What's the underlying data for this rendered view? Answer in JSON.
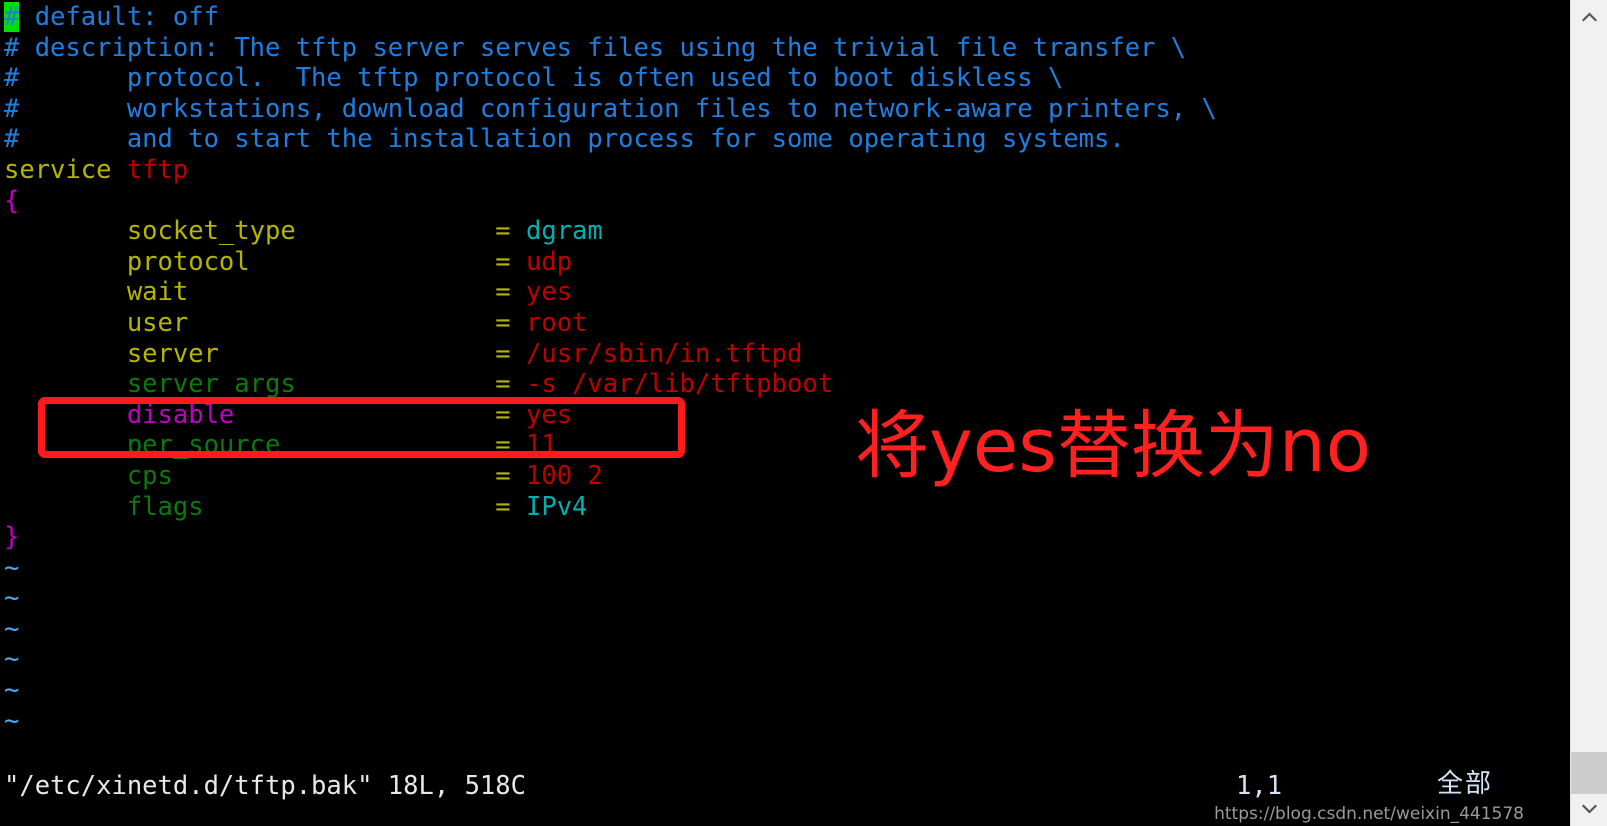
{
  "editor": {
    "lines": [
      {
        "id": "l1",
        "segments": [
          {
            "t": "#",
            "c": "cursor-block"
          },
          {
            "t": " default: off",
            "c": "c-comment"
          }
        ]
      },
      {
        "id": "l2",
        "segments": [
          {
            "t": "# description: The tftp server serves files using the trivial file transfer \\",
            "c": "c-comment"
          }
        ]
      },
      {
        "id": "l3",
        "segments": [
          {
            "t": "#       protocol.  The tftp protocol is often used to boot diskless \\",
            "c": "c-comment"
          }
        ]
      },
      {
        "id": "l4",
        "segments": [
          {
            "t": "#       workstations, download configuration files to network-aware printers, \\",
            "c": "c-comment"
          }
        ]
      },
      {
        "id": "l5",
        "segments": [
          {
            "t": "#       and to start the installation process for some operating systems.",
            "c": "c-comment"
          }
        ]
      },
      {
        "id": "l6",
        "segments": [
          {
            "t": "service ",
            "c": "c-keyword"
          },
          {
            "t": "tftp",
            "c": "c-string"
          }
        ]
      },
      {
        "id": "l7",
        "segments": [
          {
            "t": "{",
            "c": "c-brace"
          }
        ]
      },
      {
        "id": "l8",
        "segments": [
          {
            "t": "        socket_type",
            "c": "c-keyword"
          },
          {
            "t": "             = ",
            "c": "c-op"
          },
          {
            "t": "dgram",
            "c": "c-special"
          }
        ]
      },
      {
        "id": "l9",
        "segments": [
          {
            "t": "        protocol",
            "c": "c-keyword"
          },
          {
            "t": "                = ",
            "c": "c-op"
          },
          {
            "t": "udp",
            "c": "c-string"
          }
        ]
      },
      {
        "id": "l10",
        "segments": [
          {
            "t": "        wait",
            "c": "c-keyword"
          },
          {
            "t": "                    = ",
            "c": "c-op"
          },
          {
            "t": "yes",
            "c": "c-string"
          }
        ]
      },
      {
        "id": "l11",
        "segments": [
          {
            "t": "        user",
            "c": "c-keyword"
          },
          {
            "t": "                    = ",
            "c": "c-op"
          },
          {
            "t": "root",
            "c": "c-string"
          }
        ]
      },
      {
        "id": "l12",
        "segments": [
          {
            "t": "        server",
            "c": "c-keyword"
          },
          {
            "t": "                  = ",
            "c": "c-op"
          },
          {
            "t": "/usr/sbin/in.tftpd",
            "c": "c-string"
          }
        ]
      },
      {
        "id": "l13",
        "segments": [
          {
            "t": "        server_args",
            "c": "c-green"
          },
          {
            "t": "             = ",
            "c": "c-op"
          },
          {
            "t": "-s /var/lib/tftpboot",
            "c": "c-string"
          }
        ]
      },
      {
        "id": "l14",
        "segments": [
          {
            "t": "        disable",
            "c": "c-magenta"
          },
          {
            "t": "                 = ",
            "c": "c-op"
          },
          {
            "t": "yes",
            "c": "c-string"
          }
        ]
      },
      {
        "id": "l15",
        "segments": [
          {
            "t": "        per_source",
            "c": "c-green"
          },
          {
            "t": "              = ",
            "c": "c-op"
          },
          {
            "t": "11",
            "c": "c-string"
          }
        ]
      },
      {
        "id": "l16",
        "segments": [
          {
            "t": "        cps",
            "c": "c-green"
          },
          {
            "t": "                     = ",
            "c": "c-op"
          },
          {
            "t": "100 2",
            "c": "c-string"
          }
        ]
      },
      {
        "id": "l17",
        "segments": [
          {
            "t": "        flags",
            "c": "c-green"
          },
          {
            "t": "                   = ",
            "c": "c-op"
          },
          {
            "t": "IPv4",
            "c": "c-special"
          }
        ]
      },
      {
        "id": "l18",
        "segments": [
          {
            "t": "}",
            "c": "c-brace"
          }
        ]
      },
      {
        "id": "l19",
        "segments": [
          {
            "t": "~",
            "c": "c-tilde"
          }
        ]
      },
      {
        "id": "l20",
        "segments": [
          {
            "t": "~",
            "c": "c-tilde"
          }
        ]
      },
      {
        "id": "l21",
        "segments": [
          {
            "t": "~",
            "c": "c-tilde"
          }
        ]
      },
      {
        "id": "l22",
        "segments": [
          {
            "t": "~",
            "c": "c-tilde"
          }
        ]
      },
      {
        "id": "l23",
        "segments": [
          {
            "t": "~",
            "c": "c-tilde"
          }
        ]
      },
      {
        "id": "l24",
        "segments": [
          {
            "t": "~",
            "c": "c-tilde"
          }
        ]
      }
    ]
  },
  "statusline": {
    "file_info": "\"/etc/xinetd.d/tftp.bak\" 18L, 518C",
    "cursor_position": "1,1",
    "scroll_indicator": "全部"
  },
  "annotation": {
    "text": "将yes替换为no",
    "color": "#ff2020",
    "highlight_box_color": "#ff1a1a",
    "highlighted_line": "        disable                 = yes"
  },
  "watermark": {
    "text": "https://blog.csdn.net/weixin_441578"
  },
  "scrollbar": {
    "up_arrow_icon": "chevron-up-icon",
    "down_arrow_icon": "chevron-down-icon"
  }
}
